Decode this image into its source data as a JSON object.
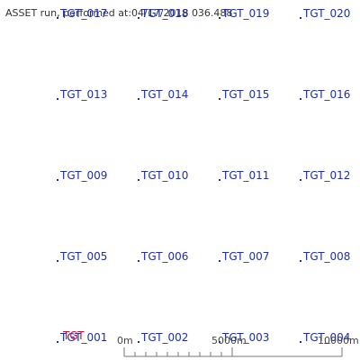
{
  "header": "ASSET run, performed at:04/17/2018 036.488",
  "targets": [
    {
      "label": "TGT_017"
    },
    {
      "label": "TGT_018"
    },
    {
      "label": "TGT_019"
    },
    {
      "label": "TGT_020"
    },
    {
      "label": "TGT_013"
    },
    {
      "label": "TGT_014"
    },
    {
      "label": "TGT_015"
    },
    {
      "label": "TGT_016"
    },
    {
      "label": "TGT_009"
    },
    {
      "label": "TGT_010"
    },
    {
      "label": "TGT_011"
    },
    {
      "label": "TGT_012"
    },
    {
      "label": "TGT_005"
    },
    {
      "label": "TGT_006"
    },
    {
      "label": "TGT_007"
    },
    {
      "label": "TGT_008"
    },
    {
      "label": "TGT_001"
    },
    {
      "label": "TGT_002"
    },
    {
      "label": "TGT_003"
    },
    {
      "label": "TGT_004"
    }
  ],
  "extra_label": "TGT",
  "scale": {
    "start": "0m",
    "mid": "5000m",
    "end": "10000m"
  },
  "colors": {
    "target": "#1f2fa6",
    "highlight": "#c8102e"
  }
}
